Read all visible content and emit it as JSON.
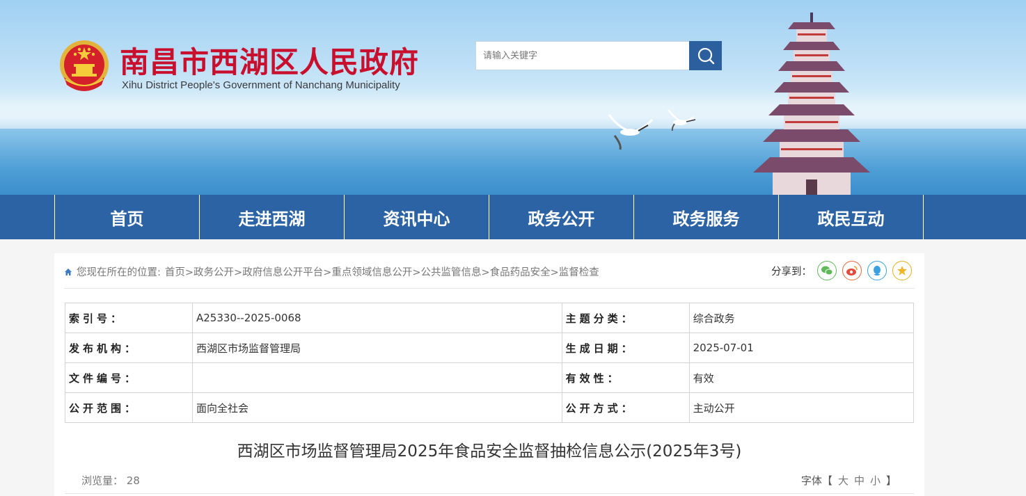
{
  "header": {
    "title": "南昌市西湖区人民政府",
    "subtitle": "Xihu District People's Government of Nanchang Municipality",
    "search_placeholder": "请输入关键字"
  },
  "nav": {
    "items": [
      {
        "label": "首页"
      },
      {
        "label": "走进西湖"
      },
      {
        "label": "资讯中心"
      },
      {
        "label": "政务公开"
      },
      {
        "label": "政务服务"
      },
      {
        "label": "政民互动"
      }
    ]
  },
  "breadcrumb": {
    "prefix": "您现在所在的位置:",
    "path": "首页>政务公开>政府信息公开平台>重点领域信息公开>公共监管信息>食品药品安全>监督检查"
  },
  "share": {
    "label": "分享到：",
    "icons": [
      "wechat-icon",
      "weibo-icon",
      "qq-icon",
      "qzone-icon"
    ]
  },
  "meta": {
    "rows": [
      {
        "k1": "索引号：",
        "v1": "A25330--2025-0068",
        "k2": "主题分类：",
        "v2": "综合政务"
      },
      {
        "k1": "发布机构：",
        "v1": "西湖区市场监督管理局",
        "k2": "生成日期：",
        "v2": "2025-07-01"
      },
      {
        "k1": "文件编号：",
        "v1": "",
        "k2": "有效性：",
        "v2": "有效"
      },
      {
        "k1": "公开范围：",
        "v1": "面向全社会",
        "k2": "公开方式：",
        "v2": "主动公开"
      }
    ]
  },
  "article": {
    "title": "西湖区市场监督管理局2025年食品安全监督抽检信息公示(2025年3号)",
    "views_label": "浏览量：",
    "views": "28",
    "font_label": "字体【",
    "font_large": "大",
    "font_medium": "中",
    "font_small": "小",
    "font_close": "】"
  },
  "colors": {
    "brand_red": "#c8102e",
    "nav_blue": "#2c63a4",
    "search_blue": "#2c5f9e"
  }
}
